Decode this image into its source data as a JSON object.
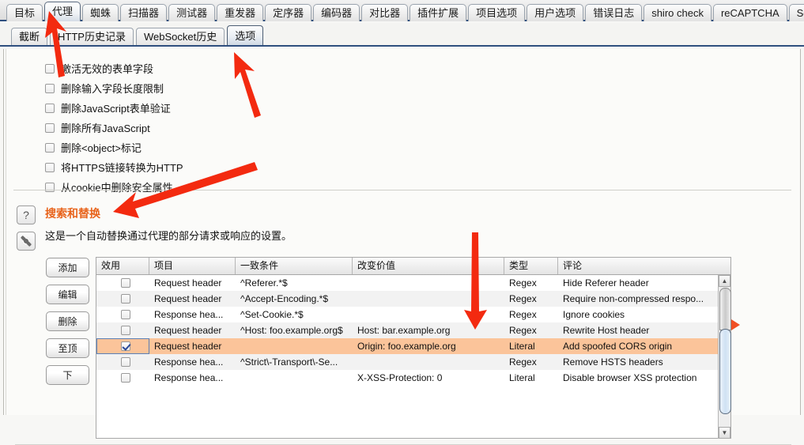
{
  "main_tabs": [
    {
      "label": "目标",
      "selected": false
    },
    {
      "label": "代理",
      "selected": true
    },
    {
      "label": "蜘蛛",
      "selected": false
    },
    {
      "label": "扫描器",
      "selected": false
    },
    {
      "label": "测试器",
      "selected": false
    },
    {
      "label": "重发器",
      "selected": false
    },
    {
      "label": "定序器",
      "selected": false
    },
    {
      "label": "编码器",
      "selected": false
    },
    {
      "label": "对比器",
      "selected": false
    },
    {
      "label": "插件扩展",
      "selected": false
    },
    {
      "label": "项目选项",
      "selected": false
    },
    {
      "label": "用户选项",
      "selected": false
    },
    {
      "label": "错误日志",
      "selected": false
    },
    {
      "label": "shiro check",
      "selected": false
    },
    {
      "label": "reCAPTCHA",
      "selected": false
    },
    {
      "label": "Sqlmap",
      "selected": false
    }
  ],
  "sub_tabs": [
    {
      "label": "截断",
      "selected": false
    },
    {
      "label": "HTTP历史记录",
      "selected": false
    },
    {
      "label": "WebSocket历史",
      "selected": false
    },
    {
      "label": "选项",
      "selected": true
    }
  ],
  "checkbox_options": [
    {
      "label": "激活无效的表单字段",
      "checked": false
    },
    {
      "label": "删除输入字段长度限制",
      "checked": false
    },
    {
      "label": "删除JavaScript表单验证",
      "checked": false
    },
    {
      "label": "删除所有JavaScript",
      "checked": false
    },
    {
      "label": "删除<object>标记",
      "checked": false
    },
    {
      "label": "将HTTPS链接转换为HTTP",
      "checked": false
    },
    {
      "label": "从cookie中删除安全属性",
      "checked": false
    }
  ],
  "section": {
    "help_icon_label": "?",
    "gear_icon_label": "",
    "title": "搜索和替换",
    "description": "这是一个自动替换通过代理的部分请求或响应的设置。"
  },
  "side_buttons": [
    {
      "label": "添加"
    },
    {
      "label": "编辑"
    },
    {
      "label": "删除"
    },
    {
      "label": "至顶"
    },
    {
      "label": "下"
    }
  ],
  "table": {
    "headers": [
      "效用",
      "项目",
      "一致条件",
      "改变价值",
      "类型",
      "评论"
    ],
    "rows": [
      {
        "enabled": false,
        "item": "Request header",
        "match": "^Referer.*$",
        "replace": "",
        "type": "Regex",
        "comment": "Hide Referer header",
        "selected": false
      },
      {
        "enabled": false,
        "item": "Request header",
        "match": "^Accept-Encoding.*$",
        "replace": "",
        "type": "Regex",
        "comment": "Require non-compressed respo...",
        "selected": false
      },
      {
        "enabled": false,
        "item": "Response hea...",
        "match": "^Set-Cookie.*$",
        "replace": "",
        "type": "Regex",
        "comment": "Ignore cookies",
        "selected": false
      },
      {
        "enabled": false,
        "item": "Request header",
        "match": "^Host: foo.example.org$",
        "replace": "Host: bar.example.org",
        "type": "Regex",
        "comment": "Rewrite Host header",
        "selected": false
      },
      {
        "enabled": true,
        "item": "Request header",
        "match": "",
        "replace": "Origin: foo.example.org",
        "type": "Literal",
        "comment": "Add spoofed CORS origin",
        "selected": true
      },
      {
        "enabled": false,
        "item": "Response hea...",
        "match": "^Strict\\-Transport\\-Se...",
        "replace": "",
        "type": "Regex",
        "comment": "Remove HSTS headers",
        "selected": false
      },
      {
        "enabled": false,
        "item": "Response hea...",
        "match": "",
        "replace": "X-XSS-Protection: 0",
        "type": "Literal",
        "comment": "Disable browser XSS protection",
        "selected": false
      }
    ]
  },
  "colors": {
    "accent_orange": "#e8631b",
    "selected_row": "#fbc49a",
    "annotation_red": "#f32a10",
    "tab_underline": "#2f4f7f"
  },
  "annotations": {
    "arrow_proxy_tab": "arrow pointing to 代理 tab",
    "arrow_options_tab": "arrow pointing to 选项 tab",
    "arrow_search_replace": "arrow pointing to 搜索和替换 heading",
    "arrow_replace_column": "arrow pointing down to 改变价值 column",
    "marker_selected_row": "orange triangle marking selected table row"
  }
}
